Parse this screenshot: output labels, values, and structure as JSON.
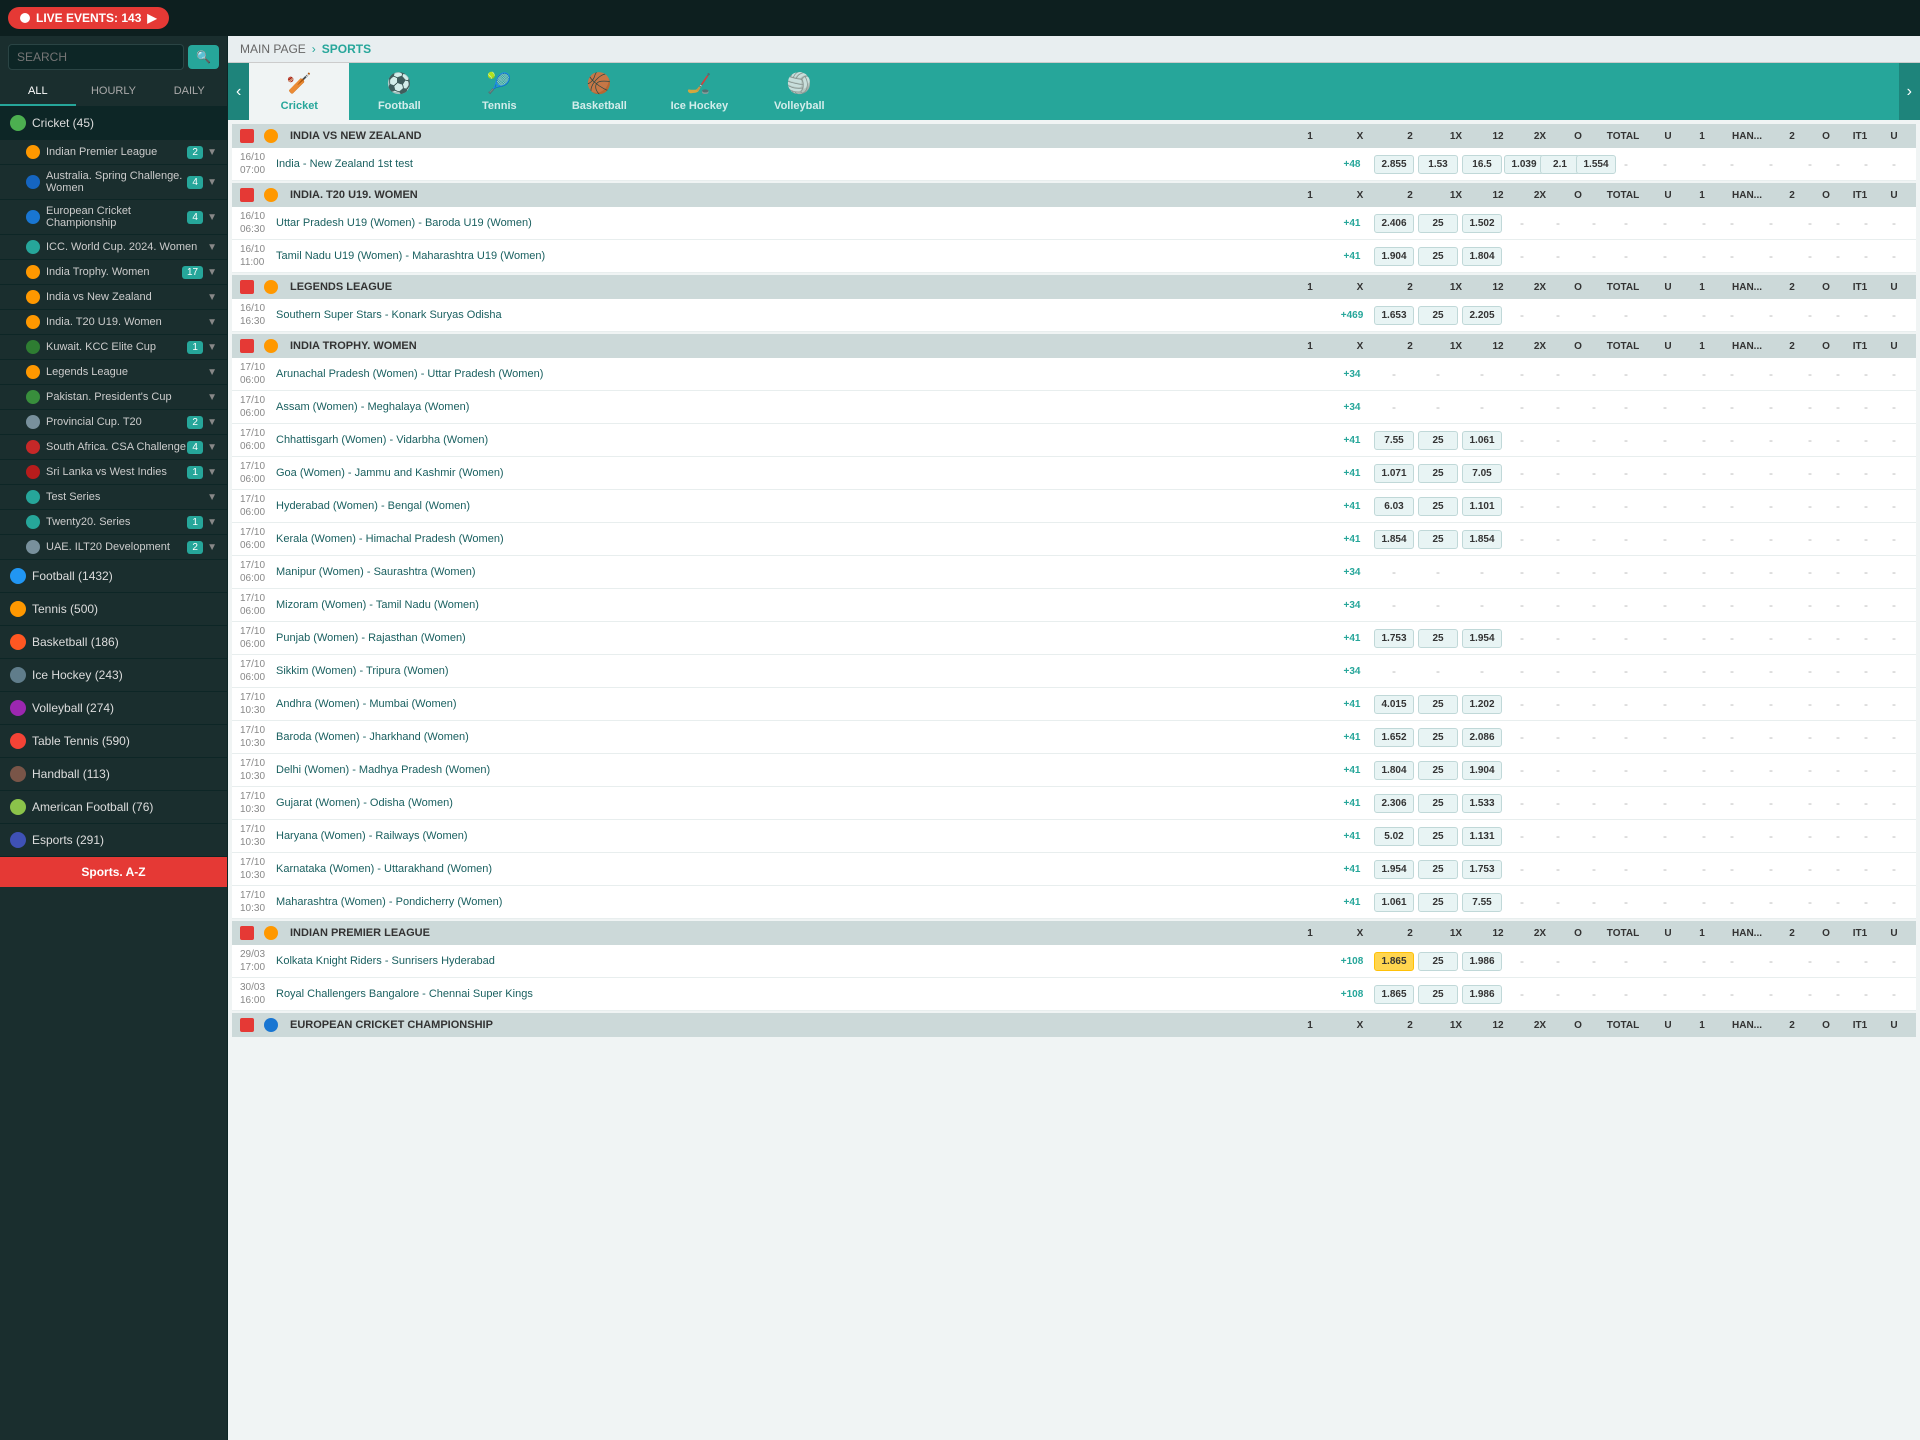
{
  "topBar": {
    "liveEvents": "LIVE EVENTS: 143"
  },
  "sidebar": {
    "searchPlaceholder": "SEARCH",
    "filterTabs": [
      "ALL",
      "HOURLY",
      "DAILY"
    ],
    "activeFilter": "ALL",
    "sports": [
      {
        "name": "Cricket (45)",
        "key": "cricket",
        "color": "cricket-dot",
        "active": true,
        "leagues": [
          {
            "name": "Indian Premier League",
            "flag": "flag-in",
            "count": 2,
            "hasChevron": true
          },
          {
            "name": "Australia. Spring Challenge. Women",
            "flag": "flag-au",
            "count": 4,
            "hasChevron": true
          },
          {
            "name": "European Cricket Championship",
            "flag": "flag-eu",
            "count": 4,
            "hasChevron": true
          },
          {
            "name": "ICC. World Cup. 2024. Women",
            "flag": "flag-globe",
            "count": "",
            "hasChevron": true
          },
          {
            "name": "India Trophy. Women",
            "flag": "flag-in",
            "count": 17,
            "hasChevron": true
          },
          {
            "name": "India vs New Zealand",
            "flag": "flag-in",
            "count": "",
            "hasChevron": true
          },
          {
            "name": "India. T20 U19. Women",
            "flag": "flag-in",
            "count": "",
            "hasChevron": true
          },
          {
            "name": "Kuwait. KCC Elite Cup",
            "flag": "flag-kw",
            "count": 1,
            "hasChevron": true
          },
          {
            "name": "Legends League",
            "flag": "flag-in",
            "count": "",
            "hasChevron": true
          },
          {
            "name": "Pakistan. President's Cup",
            "flag": "flag-pk",
            "count": "",
            "hasChevron": true
          },
          {
            "name": "Provincial Cup. T20",
            "flag": "flag-generic",
            "count": 2,
            "hasChevron": true
          },
          {
            "name": "South Africa. CSA Challenge",
            "flag": "flag-za",
            "count": 4,
            "hasChevron": true
          },
          {
            "name": "Sri Lanka vs West Indies",
            "flag": "flag-lk",
            "count": 1,
            "hasChevron": true
          },
          {
            "name": "Test Series",
            "flag": "flag-globe",
            "count": "",
            "hasChevron": true
          },
          {
            "name": "Twenty20. Series",
            "flag": "flag-globe",
            "count": 1,
            "hasChevron": true
          },
          {
            "name": "UAE. ILT20 Development",
            "flag": "flag-generic",
            "count": 2,
            "hasChevron": true
          }
        ]
      },
      {
        "name": "Football (1432)",
        "key": "football",
        "color": "football-dot",
        "active": false,
        "leagues": []
      },
      {
        "name": "Tennis (500)",
        "key": "tennis",
        "color": "tennis-dot",
        "active": false,
        "leagues": []
      },
      {
        "name": "Basketball (186)",
        "key": "basketball",
        "color": "basketball-dot",
        "active": false,
        "leagues": []
      },
      {
        "name": "Ice Hockey (243)",
        "key": "icehockey",
        "color": "icehockey-dot",
        "active": false,
        "leagues": []
      },
      {
        "name": "Volleyball (274)",
        "key": "volleyball",
        "color": "volleyball-dot",
        "active": false,
        "leagues": []
      },
      {
        "name": "Table Tennis (590)",
        "key": "tabletennis",
        "color": "tabletennis-dot",
        "active": false,
        "leagues": []
      },
      {
        "name": "Handball (113)",
        "key": "handball",
        "color": "handball-dot",
        "active": false,
        "leagues": []
      },
      {
        "name": "American Football (76)",
        "key": "americanfootball",
        "color": "americanfootball-dot",
        "active": false,
        "leagues": []
      },
      {
        "name": "Esports (291)",
        "key": "esports",
        "color": "esports-dot",
        "active": false,
        "leagues": []
      }
    ],
    "bottomLabel": "Sports. A-Z"
  },
  "breadcrumb": {
    "main": "MAIN PAGE",
    "sep": "›",
    "current": "SPORTS"
  },
  "sportsTabs": [
    {
      "label": "Cricket",
      "icon": "🏏",
      "active": true
    },
    {
      "label": "Football",
      "icon": "⚽",
      "active": false
    },
    {
      "label": "Tennis",
      "icon": "🎾",
      "active": false
    },
    {
      "label": "Basketball",
      "icon": "🏀",
      "active": false
    },
    {
      "label": "Ice Hockey",
      "icon": "🏒",
      "active": false
    },
    {
      "label": "Volleyball",
      "icon": "🏐",
      "active": false
    }
  ],
  "colHeaders": {
    "labels": [
      "1",
      "X",
      "2",
      "1X",
      "12",
      "2X",
      "O",
      "TOTAL",
      "U",
      "1",
      "HAN...",
      "2",
      "O",
      "IT1",
      "U"
    ]
  },
  "leagues": [
    {
      "name": "INDIA VS NEW ZEALAND",
      "flag": "flag-in",
      "colHeaders": [
        "1",
        "X",
        "2",
        "1X",
        "12",
        "2X",
        "O",
        "TOTAL",
        "U",
        "1",
        "HAN...",
        "2",
        "O",
        "IT1",
        "U"
      ],
      "matches": [
        {
          "time": "16/10\n07:00",
          "name": "India - New Zealand 1st test",
          "more": "+48",
          "odds": {
            "1": "2.855",
            "X": "1.53",
            "2": "16.5",
            "1X": "1.039",
            "12": "2.1",
            "2X": "1.554",
            "O": "-",
            "TOTAL": "-",
            "U": "-",
            "1H": "-",
            "HAN": "-",
            "2H": "-",
            "OH": "-",
            "IT1": "-",
            "UH": "-"
          }
        }
      ]
    },
    {
      "name": "INDIA. T20 U19. WOMEN",
      "flag": "flag-in",
      "matches": [
        {
          "time": "16/10\n06:30",
          "name": "Uttar Pradesh U19 (Women) - Baroda U19 (Women)",
          "more": "+41",
          "odds": {
            "1": "2.406",
            "X": "25",
            "2": "1.502",
            "1X": "-",
            "12": "-",
            "2X": "-",
            "O": "-",
            "TOTAL": "-",
            "U": "-",
            "1H": "-",
            "HAN": "-",
            "2H": "-",
            "OH": "-",
            "IT1": "-",
            "UH": "-"
          }
        },
        {
          "time": "16/10\n11:00",
          "name": "Tamil Nadu U19 (Women) - Maharashtra U19 (Women)",
          "more": "+41",
          "odds": {
            "1": "1.904",
            "X": "25",
            "2": "1.804",
            "1X": "-",
            "12": "-",
            "2X": "-",
            "O": "-",
            "TOTAL": "-",
            "U": "-",
            "1H": "-",
            "HAN": "-",
            "2H": "-",
            "OH": "-",
            "IT1": "-",
            "UH": "-"
          }
        }
      ]
    },
    {
      "name": "LEGENDS LEAGUE",
      "flag": "flag-in",
      "matches": [
        {
          "time": "16/10\n16:30",
          "name": "Southern Super Stars - Konark Suryas Odisha",
          "more": "+469",
          "odds": {
            "1": "1.653",
            "X": "25",
            "2": "2.205",
            "1X": "-",
            "12": "-",
            "2X": "-",
            "O": "-",
            "TOTAL": "-",
            "U": "-",
            "1H": "-",
            "HAN": "-",
            "2H": "-",
            "OH": "-",
            "IT1": "-",
            "UH": "-"
          }
        }
      ]
    },
    {
      "name": "INDIA TROPHY. WOMEN",
      "flag": "flag-in",
      "matches": [
        {
          "time": "17/10\n06:00",
          "name": "Arunachal Pradesh (Women) - Uttar Pradesh (Women)",
          "more": "+34",
          "odds": {
            "1": "-",
            "X": "-",
            "2": "-",
            "1X": "-",
            "12": "-",
            "2X": "-",
            "O": "-",
            "TOTAL": "-",
            "U": "-",
            "1H": "-",
            "HAN": "-",
            "2H": "-",
            "OH": "-",
            "IT1": "-",
            "UH": "-"
          }
        },
        {
          "time": "17/10\n06:00",
          "name": "Assam (Women) - Meghalaya (Women)",
          "more": "+34",
          "odds": {
            "1": "-",
            "X": "-",
            "2": "-",
            "1X": "-",
            "12": "-",
            "2X": "-",
            "O": "-",
            "TOTAL": "-",
            "U": "-",
            "1H": "-",
            "HAN": "-",
            "2H": "-",
            "OH": "-",
            "IT1": "-",
            "UH": "-"
          }
        },
        {
          "time": "17/10\n06:00",
          "name": "Chhattisgarh (Women) - Vidarbha (Women)",
          "more": "+41",
          "odds": {
            "1": "7.55",
            "X": "25",
            "2": "1.061",
            "1X": "-",
            "12": "-",
            "2X": "-",
            "O": "-",
            "TOTAL": "-",
            "U": "-",
            "1H": "-",
            "HAN": "-",
            "2H": "-",
            "OH": "-",
            "IT1": "-",
            "UH": "-"
          }
        },
        {
          "time": "17/10\n06:00",
          "name": "Goa (Women) - Jammu and Kashmir (Women)",
          "more": "+41",
          "odds": {
            "1": "1.071",
            "X": "25",
            "2": "7.05",
            "1X": "-",
            "12": "-",
            "2X": "-",
            "O": "-",
            "TOTAL": "-",
            "U": "-",
            "1H": "-",
            "HAN": "-",
            "2H": "-",
            "OH": "-",
            "IT1": "-",
            "UH": "-"
          }
        },
        {
          "time": "17/10\n06:00",
          "name": "Hyderabad (Women) - Bengal (Women)",
          "more": "+41",
          "odds": {
            "1": "6.03",
            "X": "25",
            "2": "1.101",
            "1X": "-",
            "12": "-",
            "2X": "-",
            "O": "-",
            "TOTAL": "-",
            "U": "-",
            "1H": "-",
            "HAN": "-",
            "2H": "-",
            "OH": "-",
            "IT1": "-",
            "UH": "-"
          }
        },
        {
          "time": "17/10\n06:00",
          "name": "Kerala (Women) - Himachal Pradesh (Women)",
          "more": "+41",
          "odds": {
            "1": "1.854",
            "X": "25",
            "2": "1.854",
            "1X": "-",
            "12": "-",
            "2X": "-",
            "O": "-",
            "TOTAL": "-",
            "U": "-",
            "1H": "-",
            "HAN": "-",
            "2H": "-",
            "OH": "-",
            "IT1": "-",
            "UH": "-"
          }
        },
        {
          "time": "17/10\n06:00",
          "name": "Manipur (Women) - Saurashtra (Women)",
          "more": "+34",
          "odds": {
            "1": "-",
            "X": "-",
            "2": "-",
            "1X": "-",
            "12": "-",
            "2X": "-",
            "O": "-",
            "TOTAL": "-",
            "U": "-",
            "1H": "-",
            "HAN": "-",
            "2H": "-",
            "OH": "-",
            "IT1": "-",
            "UH": "-"
          }
        },
        {
          "time": "17/10\n06:00",
          "name": "Mizoram (Women) - Tamil Nadu (Women)",
          "more": "+34",
          "odds": {
            "1": "-",
            "X": "-",
            "2": "-",
            "1X": "-",
            "12": "-",
            "2X": "-",
            "O": "-",
            "TOTAL": "-",
            "U": "-",
            "1H": "-",
            "HAN": "-",
            "2H": "-",
            "OH": "-",
            "IT1": "-",
            "UH": "-"
          }
        },
        {
          "time": "17/10\n06:00",
          "name": "Punjab (Women) - Rajasthan (Women)",
          "more": "+41",
          "odds": {
            "1": "1.753",
            "X": "25",
            "2": "1.954",
            "1X": "-",
            "12": "-",
            "2X": "-",
            "O": "-",
            "TOTAL": "-",
            "U": "-",
            "1H": "-",
            "HAN": "-",
            "2H": "-",
            "OH": "-",
            "IT1": "-",
            "UH": "-"
          }
        },
        {
          "time": "17/10\n06:00",
          "name": "Sikkim (Women) - Tripura (Women)",
          "more": "+34",
          "odds": {
            "1": "-",
            "X": "-",
            "2": "-",
            "1X": "-",
            "12": "-",
            "2X": "-",
            "O": "-",
            "TOTAL": "-",
            "U": "-",
            "1H": "-",
            "HAN": "-",
            "2H": "-",
            "OH": "-",
            "IT1": "-",
            "UH": "-"
          }
        },
        {
          "time": "17/10\n10:30",
          "name": "Andhra (Women) - Mumbai (Women)",
          "more": "+41",
          "odds": {
            "1": "4.015",
            "X": "25",
            "2": "1.202",
            "1X": "-",
            "12": "-",
            "2X": "-",
            "O": "-",
            "TOTAL": "-",
            "U": "-",
            "1H": "-",
            "HAN": "-",
            "2H": "-",
            "OH": "-",
            "IT1": "-",
            "UH": "-"
          }
        },
        {
          "time": "17/10\n10:30",
          "name": "Baroda (Women) - Jharkhand (Women)",
          "more": "+41",
          "odds": {
            "1": "1.652",
            "X": "25",
            "2": "2.086",
            "1X": "-",
            "12": "-",
            "2X": "-",
            "O": "-",
            "TOTAL": "-",
            "U": "-",
            "1H": "-",
            "HAN": "-",
            "2H": "-",
            "OH": "-",
            "IT1": "-",
            "UH": "-"
          }
        },
        {
          "time": "17/10\n10:30",
          "name": "Delhi (Women) - Madhya Pradesh (Women)",
          "more": "+41",
          "odds": {
            "1": "1.804",
            "X": "25",
            "2": "1.904",
            "1X": "-",
            "12": "-",
            "2X": "-",
            "O": "-",
            "TOTAL": "-",
            "U": "-",
            "1H": "-",
            "HAN": "-",
            "2H": "-",
            "OH": "-",
            "IT1": "-",
            "UH": "-"
          }
        },
        {
          "time": "17/10\n10:30",
          "name": "Gujarat (Women) - Odisha (Women)",
          "more": "+41",
          "odds": {
            "1": "2.306",
            "X": "25",
            "2": "1.533",
            "1X": "-",
            "12": "-",
            "2X": "-",
            "O": "-",
            "TOTAL": "-",
            "U": "-",
            "1H": "-",
            "HAN": "-",
            "2H": "-",
            "OH": "-",
            "IT1": "-",
            "UH": "-"
          }
        },
        {
          "time": "17/10\n10:30",
          "name": "Haryana (Women) - Railways (Women)",
          "more": "+41",
          "odds": {
            "1": "5.02",
            "X": "25",
            "2": "1.131",
            "1X": "-",
            "12": "-",
            "2X": "-",
            "O": "-",
            "TOTAL": "-",
            "U": "-",
            "1H": "-",
            "HAN": "-",
            "2H": "-",
            "OH": "-",
            "IT1": "-",
            "UH": "-"
          }
        },
        {
          "time": "17/10\n10:30",
          "name": "Karnataka (Women) - Uttarakhand (Women)",
          "more": "+41",
          "odds": {
            "1": "1.954",
            "X": "25",
            "2": "1.753",
            "1X": "-",
            "12": "-",
            "2X": "-",
            "O": "-",
            "TOTAL": "-",
            "U": "-",
            "1H": "-",
            "HAN": "-",
            "2H": "-",
            "OH": "-",
            "IT1": "-",
            "UH": "-"
          }
        },
        {
          "time": "17/10\n10:30",
          "name": "Maharashtra (Women) - Pondicherry (Women)",
          "more": "+41",
          "odds": {
            "1": "1.061",
            "X": "25",
            "2": "7.55",
            "1X": "-",
            "12": "-",
            "2X": "-",
            "O": "-",
            "TOTAL": "-",
            "U": "-",
            "1H": "-",
            "HAN": "-",
            "2H": "-",
            "OH": "-",
            "IT1": "-",
            "UH": "-"
          }
        }
      ]
    },
    {
      "name": "INDIAN PREMIER LEAGUE",
      "flag": "flag-in",
      "matches": [
        {
          "time": "29/03\n17:00",
          "name": "Kolkata Knight Riders - Sunrisers Hyderabad",
          "more": "+108",
          "odds": {
            "1": "1.865",
            "X": "25",
            "2": "1.986",
            "1X": "-",
            "12": "-",
            "2X": "-",
            "O": "-",
            "TOTAL": "-",
            "U": "-",
            "1H": "-",
            "HAN": "-",
            "2H": "-",
            "OH": "-",
            "IT1": "-",
            "UH": "-"
          },
          "highlight1": true
        },
        {
          "time": "30/03\n16:00",
          "name": "Royal Challengers Bangalore - Chennai Super Kings",
          "more": "+108",
          "odds": {
            "1": "1.865",
            "X": "25",
            "2": "1.986",
            "1X": "-",
            "12": "-",
            "2X": "-",
            "O": "-",
            "TOTAL": "-",
            "U": "-",
            "1H": "-",
            "HAN": "-",
            "2H": "-",
            "OH": "-",
            "IT1": "-",
            "UH": "-"
          }
        }
      ]
    },
    {
      "name": "EUROPEAN CRICKET CHAMPIONSHIP",
      "flag": "flag-eu",
      "matches": []
    }
  ],
  "iceHockeyBanner": {
    "title": "Ice Hockey",
    "icon": "🏒"
  }
}
